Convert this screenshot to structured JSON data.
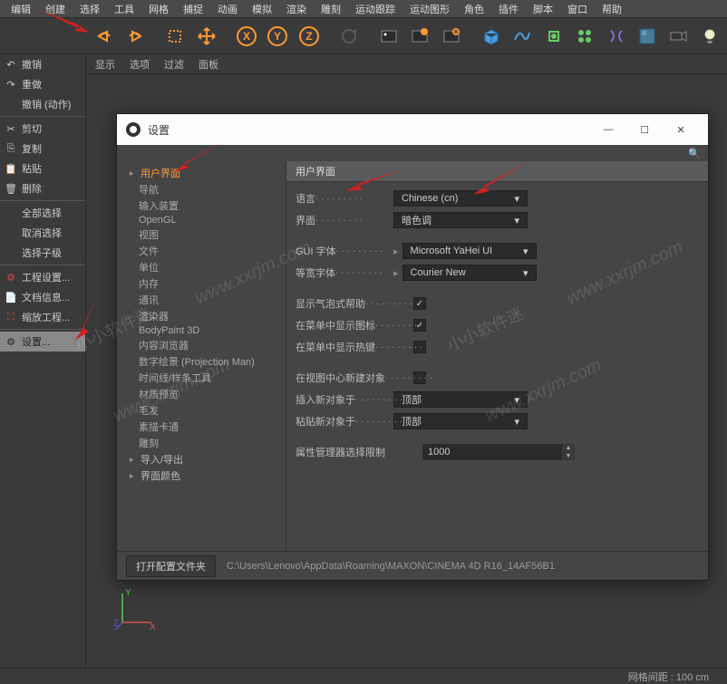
{
  "menubar": [
    "编辑",
    "创建",
    "选择",
    "工具",
    "网格",
    "捕捉",
    "动画",
    "模拟",
    "渲染",
    "雕刻",
    "运动跟踪",
    "运动图形",
    "角色",
    "插件",
    "脚本",
    "窗口",
    "帮助"
  ],
  "edit_menu": {
    "items": [
      "撤销",
      "重做",
      "撤销 (动作)"
    ],
    "items2": [
      "剪切",
      "复制",
      "粘贴",
      "删除"
    ],
    "items3": [
      "全部选择",
      "取消选择",
      "选择子级"
    ],
    "items4": [
      "工程设置...",
      "文档信息...",
      "缩放工程..."
    ],
    "settings": "设置..."
  },
  "viewport_header": [
    "显示",
    "选项",
    "过滤",
    "面板"
  ],
  "dialog": {
    "title": "设置",
    "nav": {
      "selected": "用户界面",
      "items": [
        "导航",
        "输入装置",
        "OpenGL",
        "视图",
        "文件",
        "单位",
        "内存",
        "通讯",
        "渲染器",
        "BodyPaint 3D",
        "内容浏览器",
        "数字绘景 (Projection Man)",
        "时间线/样条工具",
        "材质预览",
        "毛发",
        "素描卡通",
        "雕刻",
        "导入/导出",
        "界面颜色"
      ]
    },
    "panel": {
      "header": "用户界面",
      "lang_label": "语言",
      "lang_value": "Chinese (cn)",
      "interface_label": "界面",
      "interface_value": "暗色调",
      "gui_font_label": "GUI 字体",
      "gui_font_value": "Microsoft YaHei UI",
      "mono_font_label": "等宽字体",
      "mono_font_value": "Courier New",
      "bubble_help": "显示气泡式帮助",
      "menu_icons": "在菜单中显示图标",
      "menu_hotkeys": "在菜单中显示热键",
      "new_center": "在视图中心新建对象",
      "insert_at_label": "插入新对象于",
      "insert_at_value": "顶部",
      "paste_at_label": "粘贴新对象于",
      "paste_at_value": "顶部",
      "attr_limit_label": "属性管理器选择限制",
      "attr_limit_value": "1000"
    },
    "footer": {
      "button": "打开配置文件夹",
      "path": "C:\\Users\\Lenovo\\AppData\\Roaming\\MAXON\\CINEMA 4D R16_14AF56B1"
    }
  },
  "statusbar": {
    "grid": "网格间距 : 100 cm"
  },
  "watermark": {
    "url": "www.xxrjm.com",
    "text": "小小软件迷"
  }
}
